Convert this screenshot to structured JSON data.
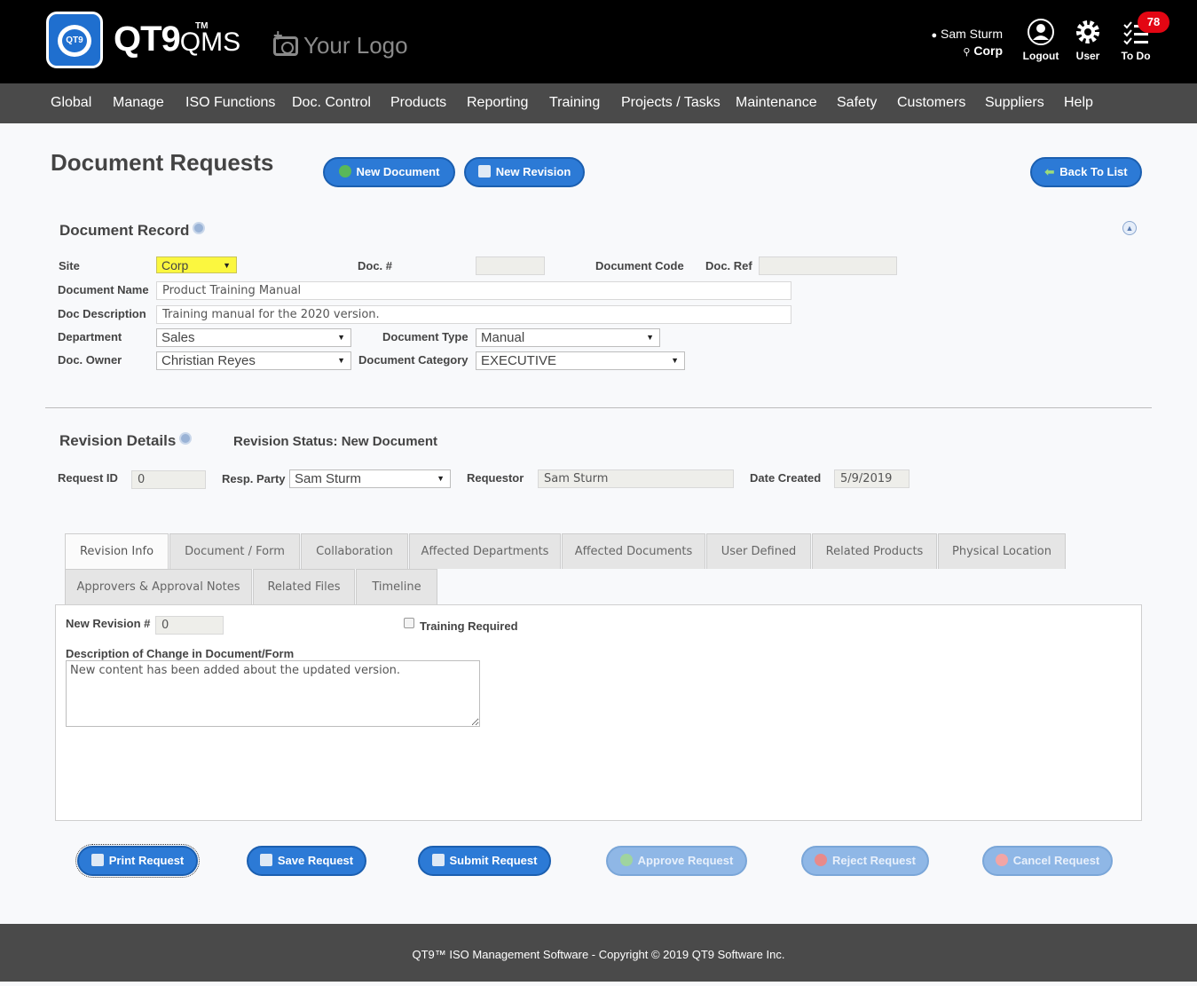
{
  "header": {
    "brand": "QT9",
    "brand_tm": "TM",
    "brand_suffix": "QMS",
    "your_logo": "Your Logo",
    "user_name": "Sam Sturm",
    "user_site": "Corp",
    "logout_label": "Logout",
    "user_label": "User",
    "todo_label": "To Do",
    "todo_count": "78"
  },
  "nav": [
    "Global",
    "Manage",
    "ISO Functions",
    "Doc. Control",
    "Products",
    "Reporting",
    "Training",
    "Projects / Tasks",
    "Maintenance",
    "Safety",
    "Customers",
    "Suppliers",
    "Help"
  ],
  "page": {
    "title": "Document Requests",
    "new_document": "New Document",
    "new_revision": "New Revision",
    "back_to_list": "Back To List"
  },
  "record": {
    "heading": "Document Record",
    "site_label": "Site",
    "site_value": "Corp",
    "doc_num_label": "Doc. #",
    "doc_num_value": "",
    "doc_code_label": "Document Code",
    "doc_ref_label": "Doc. Ref",
    "doc_ref_value": "",
    "name_label": "Document Name",
    "name_value": "Product Training Manual",
    "desc_label": "Doc Description",
    "desc_value": "Training manual for the 2020 version.",
    "dept_label": "Department",
    "dept_value": "Sales",
    "type_label": "Document Type",
    "type_value": "Manual",
    "owner_label": "Doc. Owner",
    "owner_value": "Christian Reyes",
    "category_label": "Document Category",
    "category_value": "EXECUTIVE"
  },
  "revision": {
    "heading": "Revision Details",
    "status": "Revision Status: New Document",
    "request_id_label": "Request ID",
    "request_id_value": "0",
    "resp_party_label": "Resp. Party",
    "resp_party_value": "Sam Sturm",
    "requestor_label": "Requestor",
    "requestor_value": "Sam Sturm",
    "date_created_label": "Date Created",
    "date_created_value": "5/9/2019"
  },
  "tabs_row1": [
    "Revision Info",
    "Document / Form",
    "Collaboration",
    "Affected Departments",
    "Affected Documents",
    "User Defined",
    "Related Products",
    "Physical Location"
  ],
  "tabs_row2": [
    "Approvers & Approval Notes",
    "Related Files",
    "Timeline"
  ],
  "revinfo": {
    "new_rev_label": "New Revision #",
    "new_rev_value": "0",
    "training_label": "Training Required",
    "desc_change_label": "Description of Change in Document/Form",
    "desc_change_value": "New content has been added about the updated version."
  },
  "actions": {
    "print": "Print Request",
    "save": "Save Request",
    "submit": "Submit Request",
    "approve": "Approve Request",
    "reject": "Reject Request",
    "cancel": "Cancel Request"
  },
  "footer": "QT9™ ISO Management Software - Copyright © 2019 QT9 Software Inc.",
  "colors": {
    "accent": "#2c7ad6",
    "site_highlight": "#fbf73f",
    "badge": "#e30613"
  }
}
